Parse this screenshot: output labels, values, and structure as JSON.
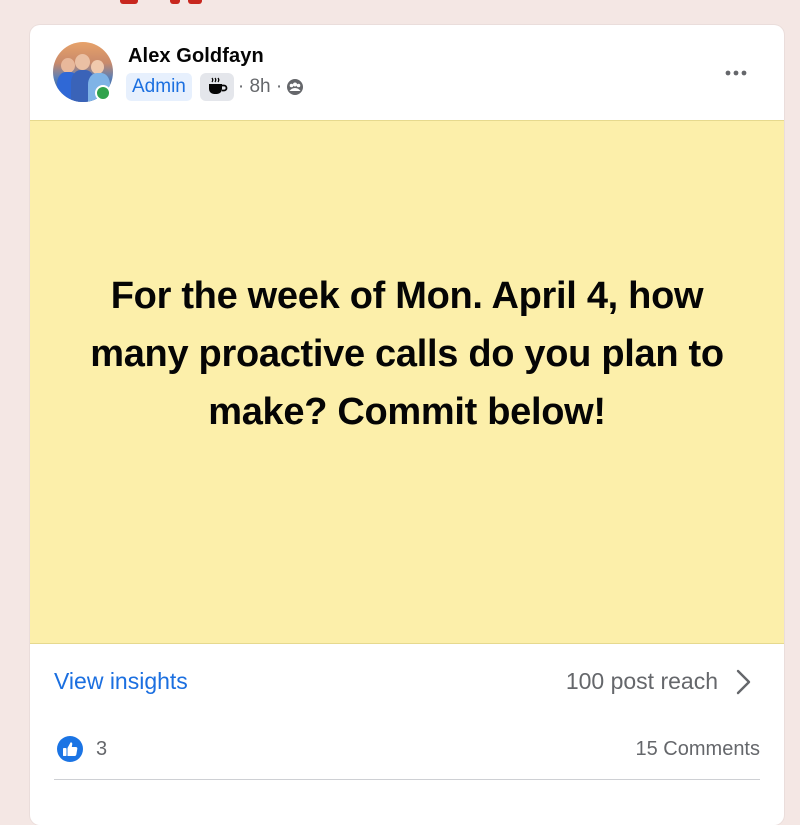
{
  "post": {
    "author": {
      "name": "Alex Goldfayn",
      "role_badge": "Admin",
      "online": true
    },
    "meta": {
      "time_text": "· 8h ·"
    },
    "body_text": "For the week of Mon. April 4, how many proactive calls do you plan to make? Commit below!",
    "background_color": "#fcefaa",
    "insights": {
      "link_label": "View insights",
      "reach_text": "100 post reach"
    },
    "reactions": {
      "like_count": "3",
      "comments_text": "15 Comments"
    }
  },
  "icons": {
    "more": "more-horizontal-icon",
    "coffee": "coffee-cup-icon",
    "audience": "group-audience-icon",
    "chevron": "chevron-right-icon",
    "like": "like-thumbs-up-icon"
  },
  "colors": {
    "accent_blue": "#1b6fe0",
    "online_green": "#31a24c",
    "page_background": "#f4e7e4"
  }
}
